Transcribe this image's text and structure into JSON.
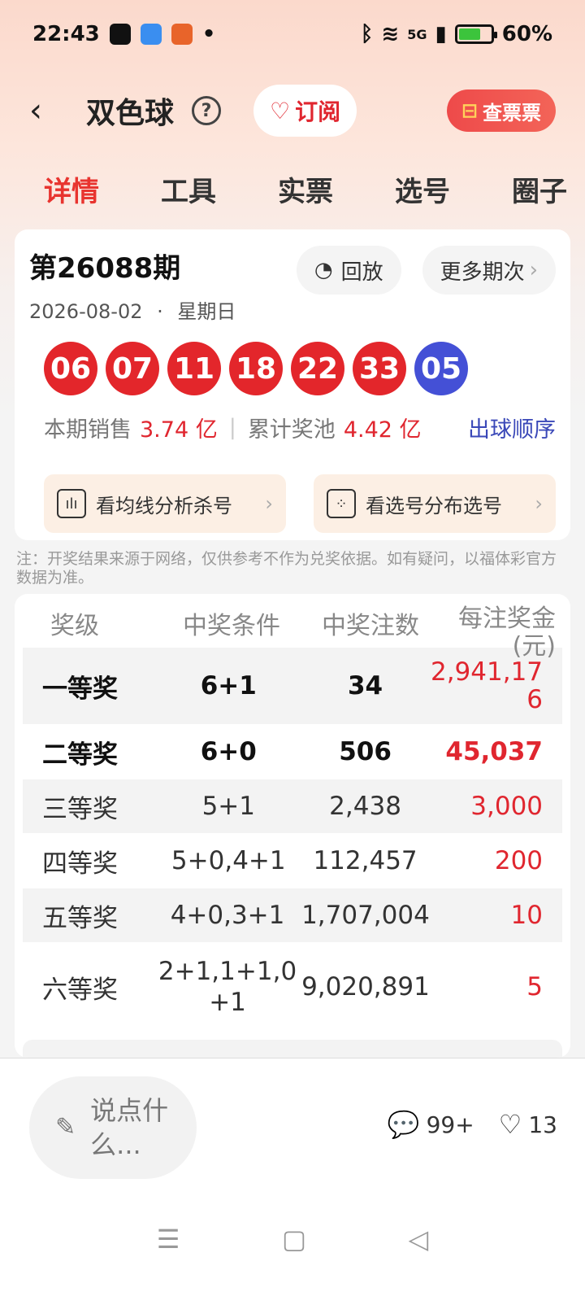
{
  "status_bar": {
    "time": "22:43",
    "signal": "5G",
    "battery": "60%"
  },
  "nav": {
    "title": "双色球",
    "subscribe_label": "订阅",
    "check_ticket_label": "查票票"
  },
  "tabs": [
    {
      "label": "详情",
      "active": true
    },
    {
      "label": "工具",
      "active": false
    },
    {
      "label": "实票",
      "active": false
    },
    {
      "label": "选号",
      "active": false
    },
    {
      "label": "圈子",
      "active": false
    }
  ],
  "draw": {
    "issue": "第26088期",
    "date": "2026-08-02",
    "weekday": "星期日",
    "date_sep": "·",
    "replay_label": "回放",
    "more_label": "更多期次",
    "red_balls": [
      "06",
      "07",
      "11",
      "18",
      "22",
      "33"
    ],
    "blue_ball": "05",
    "colors": {
      "red": "#e3262b",
      "blue": "#4450d6"
    },
    "sales_label": "本期销售",
    "sales_value": "3.74 亿",
    "pool_label": "累计奖池",
    "pool_value": "4.42 亿",
    "order_label": "出球顺序",
    "analysis_buttons": [
      {
        "label": "看均线分析杀号",
        "icon": "chart-icon"
      },
      {
        "label": "看选号分布选号",
        "icon": "dice-icon"
      }
    ]
  },
  "note": "注：开奖结果来源于网络，仅供参考不作为兑奖依据。如有疑问，以福体彩官方数据为准。",
  "prize_table": {
    "headers": [
      "奖级",
      "中奖条件",
      "中奖注数",
      "每注奖金(元)"
    ],
    "rows": [
      {
        "level": "一等奖",
        "condition": "6+1",
        "count": "34",
        "amount": "2,941,176"
      },
      {
        "level": "二等奖",
        "condition": "6+0",
        "count": "506",
        "amount": "45,037"
      },
      {
        "level": "三等奖",
        "condition": "5+1",
        "count": "2,438",
        "amount": "3,000"
      },
      {
        "level": "四等奖",
        "condition": "5+0,4+1",
        "count": "112,457",
        "amount": "200"
      },
      {
        "level": "五等奖",
        "condition": "4+0,3+1",
        "count": "1,707,004",
        "amount": "10"
      },
      {
        "level": "六等奖",
        "condition": "2+1,1+1,0+1",
        "count": "9,020,891",
        "amount": "5"
      }
    ]
  },
  "bottom": {
    "comment_placeholder": "说点什么...",
    "comment_count": "99+",
    "like_count": "13"
  }
}
